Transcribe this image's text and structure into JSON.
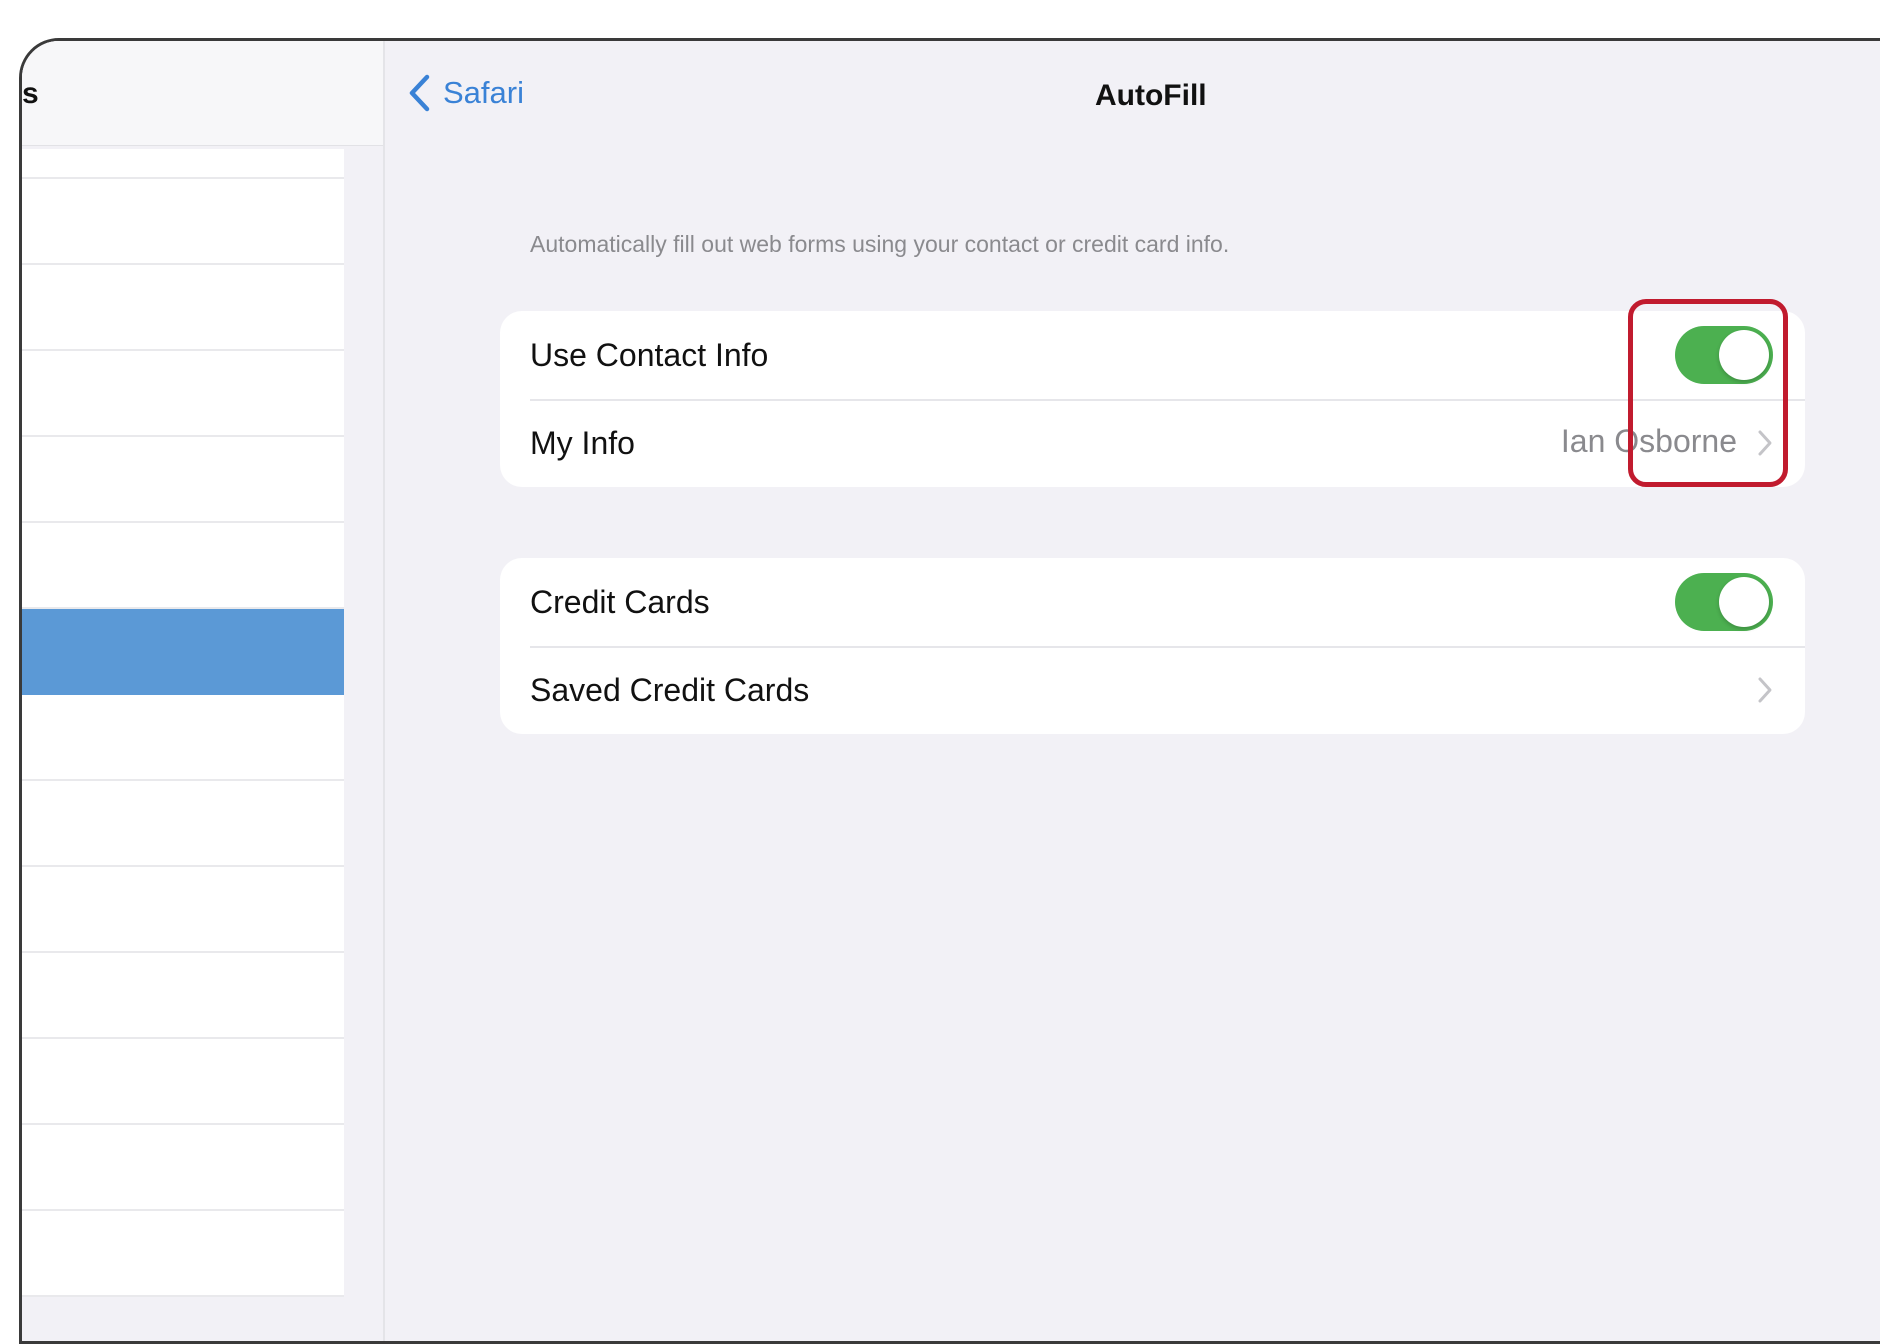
{
  "sidebar": {
    "title": "s",
    "selected_index": 5
  },
  "nav": {
    "back_label": "Safari",
    "title": "AutoFill"
  },
  "autofill": {
    "description": "Automatically fill out web forms using your contact or credit card info.",
    "contact_group": {
      "use_contact_info_label": "Use Contact Info",
      "use_contact_info_on": true,
      "my_info_label": "My Info",
      "my_info_value": "Ian Osborne"
    },
    "card_group": {
      "credit_cards_label": "Credit Cards",
      "credit_cards_on": true,
      "saved_credit_cards_label": "Saved Credit Cards"
    }
  },
  "colors": {
    "accent": "#3a82d6",
    "toggle_on": "#4cb050",
    "highlight": "#c11b2e",
    "sidebar_selected": "#5b99d6"
  },
  "icons": {
    "back": "chevron-left-icon",
    "disclosure": "chevron-right-icon"
  }
}
